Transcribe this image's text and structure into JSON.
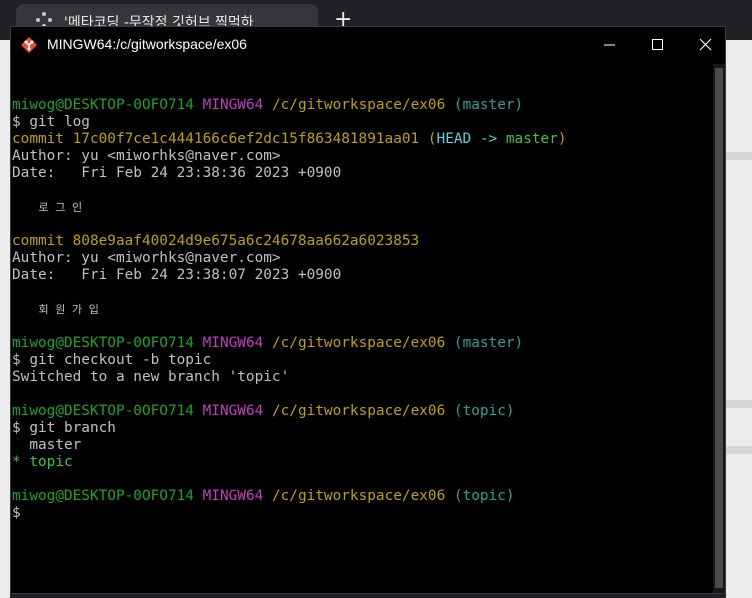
{
  "browser": {
    "tab_title": "'메타코딩 -무작정 깃허브 찍먹하",
    "new_tab": "+"
  },
  "window": {
    "title": "MINGW64:/c/gitworkspace/ex06",
    "minimize": "minimize",
    "maximize": "maximize",
    "close": "close"
  },
  "terminal": {
    "lines": [
      {
        "type": "blank"
      },
      {
        "type": "prompt",
        "user": "miwog@DESKTOP-0OFO714",
        "sys": "MINGW64",
        "path": "/c/gitworkspace/ex06",
        "branch": "(master)"
      },
      {
        "type": "text",
        "text": "$ git log"
      },
      {
        "type": "commit",
        "text": "commit 17c00f7ce1c444166c6ef2dc15f863481891aa01",
        "head_open": "(",
        "head": "HEAD ->",
        "head_branch": "master",
        "head_close": ")"
      },
      {
        "type": "text",
        "text": "Author: yu <miworhks@naver.com>"
      },
      {
        "type": "text",
        "text": "Date:   Fri Feb 24 23:38:36 2023 +0900"
      },
      {
        "type": "blank"
      },
      {
        "type": "kr",
        "text": "    로 그 인"
      },
      {
        "type": "blank"
      },
      {
        "type": "commit2",
        "text": "commit 808e9aaf40024d9e675a6c24678aa662a6023853"
      },
      {
        "type": "text",
        "text": "Author: yu <miworhks@naver.com>"
      },
      {
        "type": "text",
        "text": "Date:   Fri Feb 24 23:38:07 2023 +0900"
      },
      {
        "type": "blank"
      },
      {
        "type": "kr",
        "text": "    회 원 가 입"
      },
      {
        "type": "blank"
      },
      {
        "type": "prompt",
        "user": "miwog@DESKTOP-0OFO714",
        "sys": "MINGW64",
        "path": "/c/gitworkspace/ex06",
        "branch": "(master)"
      },
      {
        "type": "text",
        "text": "$ git checkout -b topic"
      },
      {
        "type": "text",
        "text": "Switched to a new branch 'topic'"
      },
      {
        "type": "blank"
      },
      {
        "type": "prompt",
        "user": "miwog@DESKTOP-0OFO714",
        "sys": "MINGW64",
        "path": "/c/gitworkspace/ex06",
        "branch": "(topic)"
      },
      {
        "type": "text",
        "text": "$ git branch"
      },
      {
        "type": "text",
        "text": "  master"
      },
      {
        "type": "current",
        "star": "* ",
        "text": "topic"
      },
      {
        "type": "blank"
      },
      {
        "type": "prompt",
        "user": "miwog@DESKTOP-0OFO714",
        "sys": "MINGW64",
        "path": "/c/gitworkspace/ex06",
        "branch": "(topic)"
      },
      {
        "type": "text",
        "text": "$"
      }
    ]
  },
  "colors": {
    "prompt_user": "#1aa520",
    "prompt_sys": "#bf3fbf",
    "prompt_path": "#c0a000",
    "prompt_branch": "#2aa198",
    "commit": "#c0a000",
    "head": "#5ad0e0",
    "current_branch": "#3cc33c"
  }
}
